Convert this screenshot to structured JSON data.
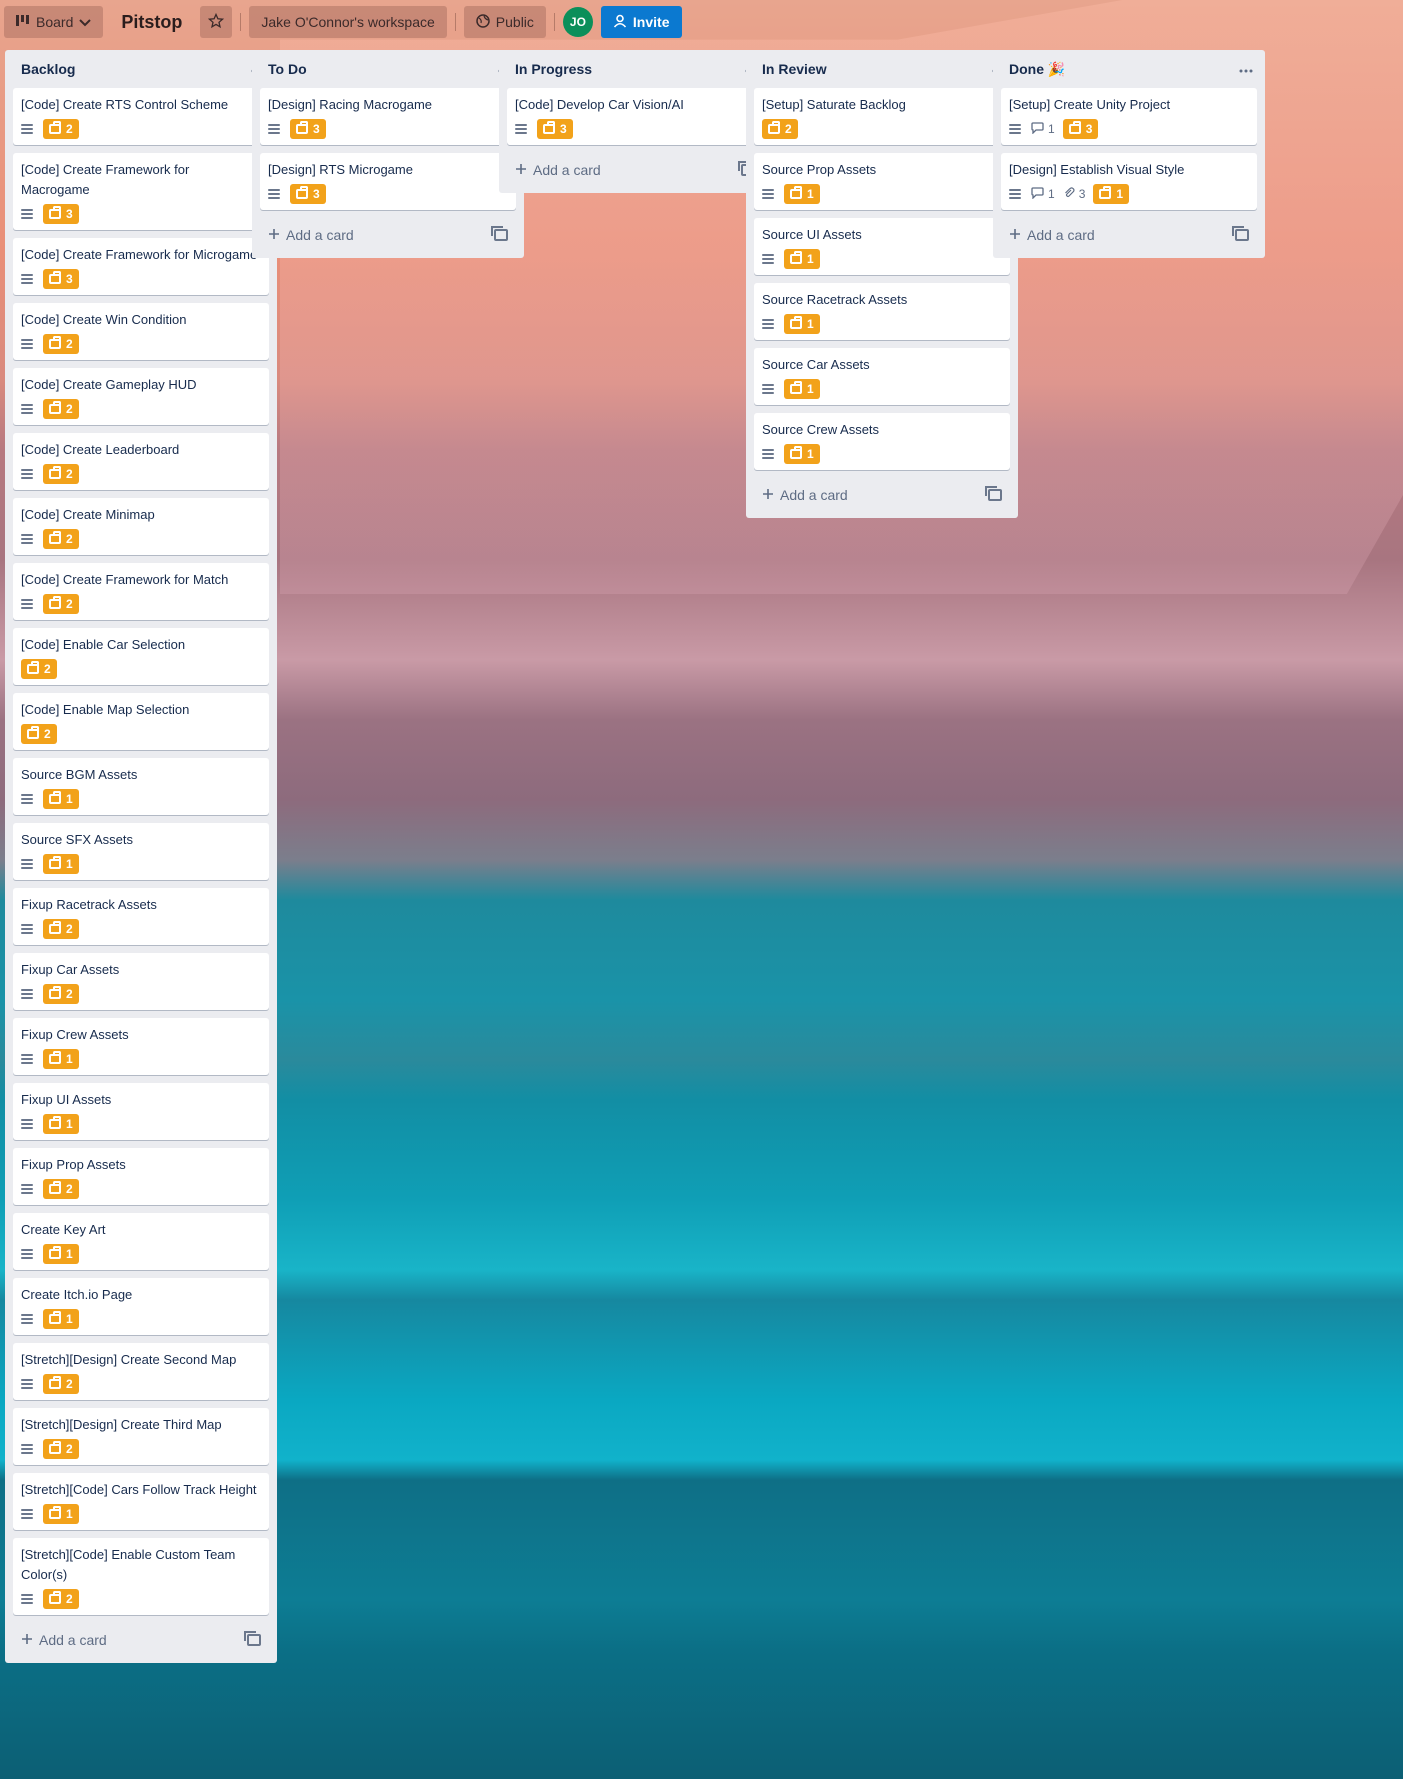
{
  "header": {
    "view_label": "Board",
    "title": "Pitstop",
    "workspace": "Jake O'Connor's workspace",
    "visibility": "Public",
    "avatar_initials": "JO",
    "invite_label": "Invite"
  },
  "add_card_label": "Add a card",
  "colors": {
    "points_badge": "#f2a21a",
    "invite": "#0b79d0",
    "avatar": "#0b8f5a"
  },
  "lists": [
    {
      "title": "Backlog",
      "cards": [
        {
          "title": "[Code] Create RTS Control Scheme",
          "desc": true,
          "points": "2"
        },
        {
          "title": "[Code] Create Framework for Macrogame",
          "desc": true,
          "points": "3"
        },
        {
          "title": "[Code] Create Framework for Microgame",
          "desc": true,
          "points": "3"
        },
        {
          "title": "[Code] Create Win Condition",
          "desc": true,
          "points": "2"
        },
        {
          "title": "[Code] Create Gameplay HUD",
          "desc": true,
          "points": "2"
        },
        {
          "title": "[Code] Create Leaderboard",
          "desc": true,
          "points": "2"
        },
        {
          "title": "[Code] Create Minimap",
          "desc": true,
          "points": "2"
        },
        {
          "title": "[Code] Create Framework for Match",
          "desc": true,
          "points": "2"
        },
        {
          "title": "[Code] Enable Car Selection",
          "desc": false,
          "points": "2"
        },
        {
          "title": "[Code] Enable Map Selection",
          "desc": false,
          "points": "2"
        },
        {
          "title": "Source BGM Assets",
          "desc": true,
          "points": "1"
        },
        {
          "title": "Source SFX Assets",
          "desc": true,
          "points": "1"
        },
        {
          "title": "Fixup Racetrack Assets",
          "desc": true,
          "points": "2"
        },
        {
          "title": "Fixup Car Assets",
          "desc": true,
          "points": "2"
        },
        {
          "title": "Fixup Crew Assets",
          "desc": true,
          "points": "1"
        },
        {
          "title": "Fixup UI Assets",
          "desc": true,
          "points": "1"
        },
        {
          "title": "Fixup Prop Assets",
          "desc": true,
          "points": "2"
        },
        {
          "title": "Create Key Art",
          "desc": true,
          "points": "1"
        },
        {
          "title": "Create Itch.io Page",
          "desc": true,
          "points": "1"
        },
        {
          "title": "[Stretch][Design] Create Second Map",
          "desc": true,
          "points": "2"
        },
        {
          "title": "[Stretch][Design] Create Third Map",
          "desc": true,
          "points": "2"
        },
        {
          "title": "[Stretch][Code] Cars Follow Track Height",
          "desc": true,
          "points": "1"
        },
        {
          "title": "[Stretch][Code] Enable Custom Team Color(s)",
          "desc": true,
          "points": "2"
        }
      ]
    },
    {
      "title": "To Do",
      "cards": [
        {
          "title": "[Design] Racing Macrogame",
          "desc": true,
          "points": "3"
        },
        {
          "title": "[Design] RTS Microgame",
          "desc": true,
          "points": "3"
        }
      ]
    },
    {
      "title": "In Progress",
      "cards": [
        {
          "title": "[Code] Develop Car Vision/AI",
          "desc": true,
          "points": "3"
        }
      ]
    },
    {
      "title": "In Review",
      "cards": [
        {
          "title": "[Setup] Saturate Backlog",
          "desc": false,
          "points": "2"
        },
        {
          "title": "Source Prop Assets",
          "desc": true,
          "points": "1"
        },
        {
          "title": "Source UI Assets",
          "desc": true,
          "points": "1"
        },
        {
          "title": "Source Racetrack Assets",
          "desc": true,
          "points": "1"
        },
        {
          "title": "Source Car Assets",
          "desc": true,
          "points": "1"
        },
        {
          "title": "Source Crew Assets",
          "desc": true,
          "points": "1"
        }
      ]
    },
    {
      "title": "Done 🎉",
      "cards": [
        {
          "title": "[Setup] Create Unity Project",
          "desc": true,
          "comments": "1",
          "points": "3"
        },
        {
          "title": "[Design] Establish Visual Style",
          "desc": true,
          "comments": "1",
          "attachments": "3",
          "points": "1"
        }
      ]
    }
  ]
}
